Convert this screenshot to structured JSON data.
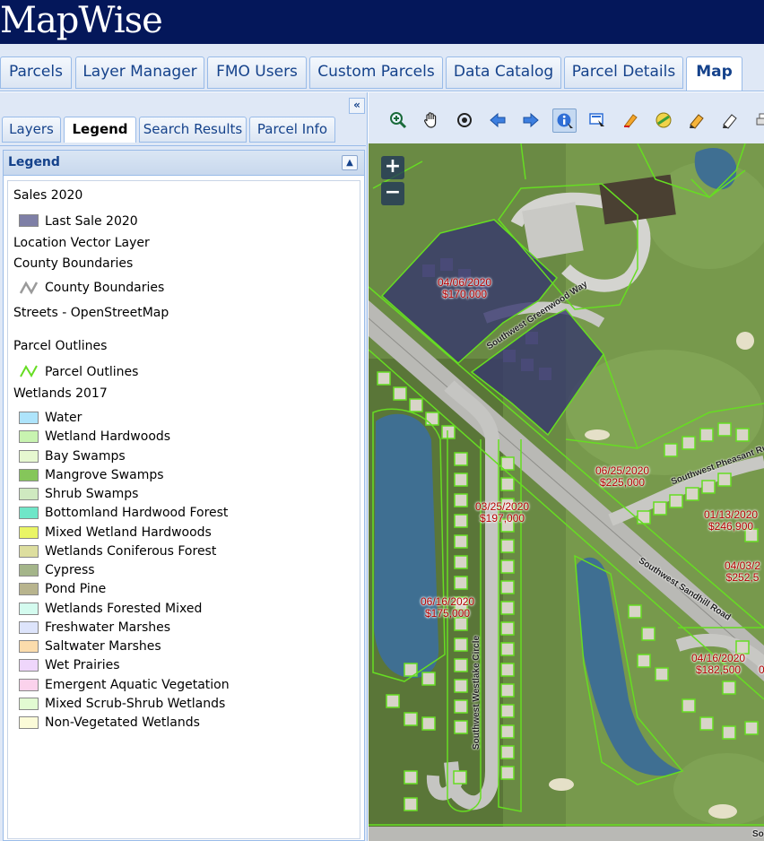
{
  "app": {
    "logo": "MapWise"
  },
  "top_tabs": [
    {
      "label": "Parcels",
      "active": false
    },
    {
      "label": "Layer Manager",
      "active": false
    },
    {
      "label": "FMO Users",
      "active": false
    },
    {
      "label": "Custom Parcels",
      "active": false
    },
    {
      "label": "Data Catalog",
      "active": false
    },
    {
      "label": "Parcel Details",
      "active": false
    },
    {
      "label": "Map",
      "active": true
    }
  ],
  "left_panel": {
    "collapse_glyph": "«",
    "tabs": [
      {
        "label": "Layers",
        "active": false
      },
      {
        "label": "Legend",
        "active": true
      },
      {
        "label": "Search Results",
        "active": false
      },
      {
        "label": "Parcel Info",
        "active": false
      }
    ],
    "legend": {
      "title": "Legend",
      "toggle_glyph": "▲",
      "sections": {
        "sales": {
          "title": "Sales 2020",
          "item": "Last Sale 2020",
          "color": "#7e7fa6"
        },
        "location": {
          "title": "Location Vector Layer"
        },
        "county": {
          "title": "County Boundaries",
          "item": "County Boundaries",
          "color": "#9a9a9a"
        },
        "streets": {
          "title": "Streets - OpenStreetMap"
        },
        "parcels": {
          "title": "Parcel Outlines",
          "item": "Parcel Outlines",
          "color": "#66dd22"
        },
        "wetlands": {
          "title": "Wetlands 2017",
          "items": [
            {
              "label": "Water",
              "color": "#aee4fb"
            },
            {
              "label": "Wetland Hardwoods",
              "color": "#c8f3b0"
            },
            {
              "label": "Bay Swamps",
              "color": "#e6f8d0"
            },
            {
              "label": "Mangrove Swamps",
              "color": "#85c65a"
            },
            {
              "label": "Shrub Swamps",
              "color": "#cfe9c0"
            },
            {
              "label": "Bottomland Hardwood Forest",
              "color": "#6fe6c8"
            },
            {
              "label": "Mixed Wetland Hardwoods",
              "color": "#eaf565"
            },
            {
              "label": "Wetlands Coniferous Forest",
              "color": "#ddde9f"
            },
            {
              "label": "Cypress",
              "color": "#a4b58a"
            },
            {
              "label": "Pond Pine",
              "color": "#b8b48e"
            },
            {
              "label": "Wetlands Forested Mixed",
              "color": "#d4fbef"
            },
            {
              "label": "Freshwater Marshes",
              "color": "#dde4fb"
            },
            {
              "label": "Saltwater Marshes",
              "color": "#fbdcac"
            },
            {
              "label": "Wet Prairies",
              "color": "#efd6fb"
            },
            {
              "label": "Emergent Aquatic Vegetation",
              "color": "#fbd2ec"
            },
            {
              "label": "Mixed Scrub-Shrub Wetlands",
              "color": "#e2fbd2"
            },
            {
              "label": "Non-Vegetated Wetlands",
              "color": "#fbfbd8"
            }
          ]
        }
      }
    }
  },
  "map": {
    "toolbar_icons": [
      "zoom-in-icon",
      "pan-hand-icon",
      "center-target-icon",
      "back-arrow-icon",
      "forward-arrow-icon",
      "identify-info-icon",
      "select-box-icon",
      "highlight-marker-icon",
      "measure-globe-icon",
      "draw-pencil-icon",
      "edit-pencil-icon",
      "print-icon"
    ],
    "selected_tool": "identify-info-icon",
    "zoom": {
      "in": "+",
      "out": "−"
    },
    "sale_labels": [
      {
        "date": "04/06/2020",
        "price": "$170,000"
      },
      {
        "date": "06/25/2020",
        "price": "$225,000"
      },
      {
        "date": "03/25/2020",
        "price": "$197,000"
      },
      {
        "date": "01/13/2020",
        "price": "$246,900"
      },
      {
        "date": "04/03/2",
        "price": "$252,5"
      },
      {
        "date": "06/16/2020",
        "price": "$175,000"
      },
      {
        "date": "04/16/2020",
        "price": "$182,500"
      },
      {
        "date": "0",
        "price": ""
      }
    ],
    "street_labels": {
      "greenwood": "Southwest Greenwood Way",
      "pheasant": "Southwest Pheasant Ru",
      "sandhill": "Southwest Sandhill Road",
      "westlake": "Southwest Westlake Circle",
      "bottom": "So"
    }
  }
}
